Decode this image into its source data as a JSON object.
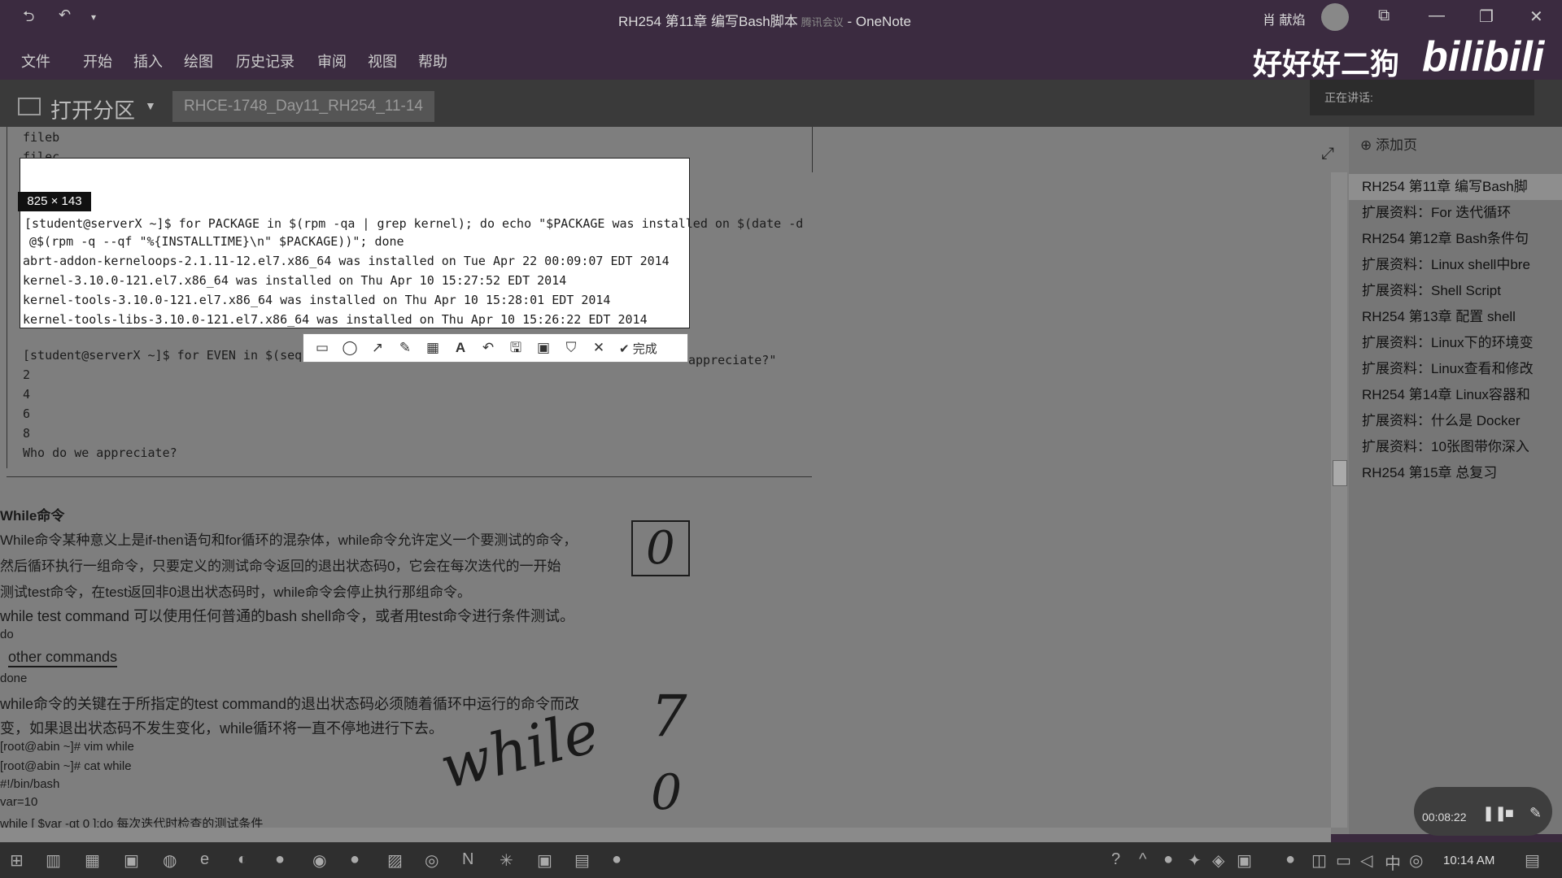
{
  "window": {
    "title": "RH254 第11章 编写Bash脚本",
    "title_overlay": "腾讯会议",
    "app": "OneNote",
    "user": "肖 献焰"
  },
  "menu": [
    "文件",
    "开始",
    "插入",
    "绘图",
    "历史记录",
    "审阅",
    "视图",
    "帮助"
  ],
  "watermark": {
    "uploader": "好好好二狗",
    "site": "bilibili"
  },
  "notebook": {
    "label": "打开分区",
    "section_tab": "RHCE-1748_Day11_RH254_11-14"
  },
  "meeting": {
    "speaking": "正在讲话:"
  },
  "note": {
    "top_lines": [
      "fileb",
      "filec"
    ],
    "capture_dims": "825 × 143",
    "capture_lines": [
      "[student@serverX ~]$ for PACKAGE in $(rpm -qa | grep kernel); do echo \"$PACKAGE was installed on $(date -d",
      "@$(rpm -q --qf \"%{INSTALLTIME}\\n\" $PACKAGE))\"; done",
      "abrt-addon-kerneloops-2.1.11-12.el7.x86_64 was installed on Tue Apr 22 00:09:07 EDT 2014",
      "kernel-3.10.0-121.el7.x86_64 was installed on Thu Apr 10 15:27:52 EDT 2014",
      "kernel-tools-3.10.0-121.el7.x86_64 was installed on Thu Apr 10 15:28:01 EDT 2014",
      "kernel-tools-libs-3.10.0-121.el7.x86_64 was installed on Thu Apr 10 15:26:22 EDT 2014"
    ],
    "done_label": "完成",
    "even_cmd": "[student@serverX ~]$ for EVEN in $(seq",
    "even_tail": "appreciate?\"",
    "even_values": [
      "2",
      "4",
      "6",
      "8"
    ],
    "appreciate": "Who do we appreciate?",
    "while_heading": "While命令",
    "while_para": [
      "While命令某种意义上是if-then语句和for循环的混杂体，while命令允许定义一个要测试的命令，",
      "然后循环执行一组命令，只要定义的测试命令返回的退出状态码0，它会在每次迭代的一开始",
      "测试test命令，在test返回非0退出状态码时，while命令会停止执行那组命令。"
    ],
    "syntax": [
      "while test command  可以使用任何普通的bash shell命令，或者用test命令进行条件测试。",
      "do",
      "other commands",
      "done"
    ],
    "key_para": [
      "while命令的关键在于所指定的test command的退出状态码必须随着循环中运行的命令而改",
      "变，如果退出状态码不发生变化，while循环将一直不停地进行下去。"
    ],
    "shell": [
      "[root@abin ~]# vim while",
      "[root@abin ~]# cat while",
      "#!/bin/bash",
      "var=10",
      "while [ $var -gt 0 ];do 每次迭代时检查的测试条件"
    ],
    "ink": [
      "while",
      "0",
      "7"
    ]
  },
  "sidebar": {
    "add_page": "添加页",
    "pages": [
      "RH254 第11章 编写Bash脚",
      "扩展资料：For 迭代循环",
      "RH254 第12章 Bash条件句",
      "扩展资料：Linux shell中bre",
      "扩展资料：Shell Script",
      "RH254 第13章 配置 shell",
      "扩展资料：Linux下的环境变",
      "扩展资料：Linux查看和修改",
      "RH254 第14章 Linux容器和",
      "扩展资料：什么是 Docker",
      "扩展资料：10张图带你深入",
      "RH254 第15章 总复习"
    ]
  },
  "recorder": {
    "time": "00:08:22"
  },
  "taskbar": {
    "time": "10:14 AM"
  }
}
